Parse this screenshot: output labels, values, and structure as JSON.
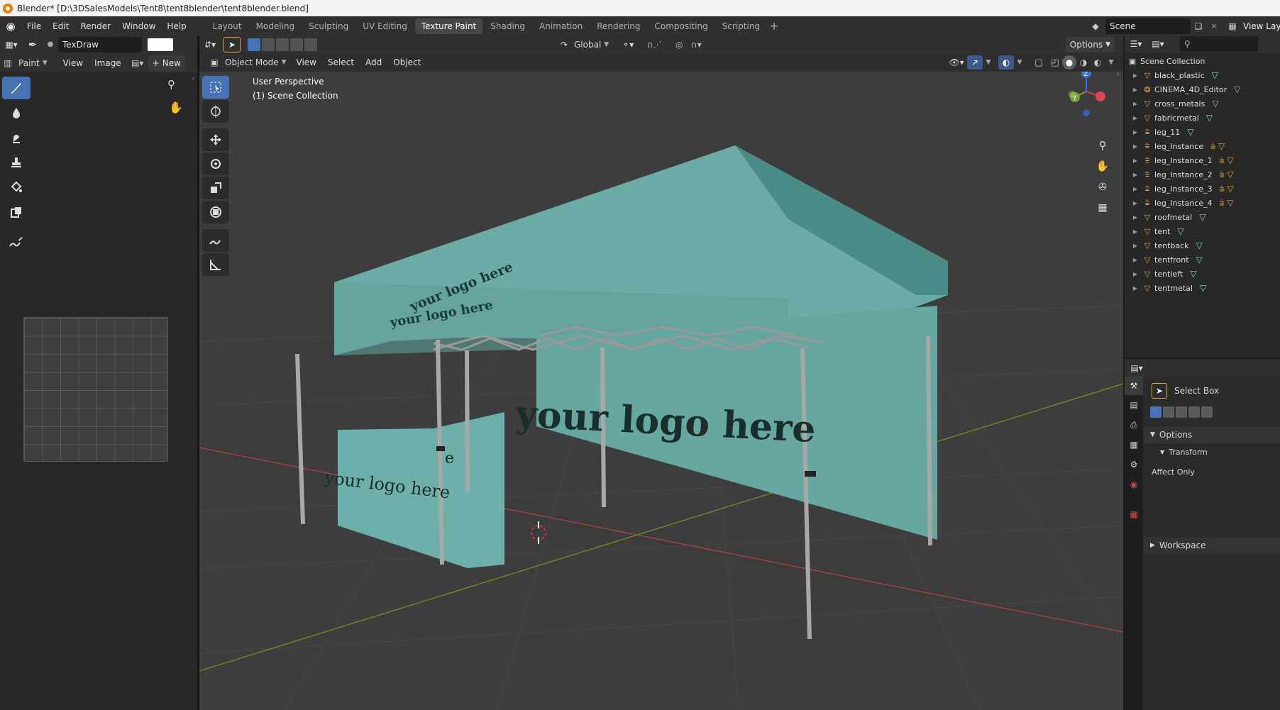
{
  "window_title": "Blender* [D:\\3DSalesModels\\Tent8\\tent8blender\\tent8blender.blend]",
  "menu": [
    "File",
    "Edit",
    "Render",
    "Window",
    "Help"
  ],
  "workspace_tabs": [
    "Layout",
    "Modeling",
    "Sculpting",
    "UV Editing",
    "Texture Paint",
    "Shading",
    "Animation",
    "Rendering",
    "Compositing",
    "Scripting"
  ],
  "active_workspace": "Texture Paint",
  "scene_name": "Scene",
  "view_layer_label": "View Laye",
  "image_editor": {
    "brush_name": "TexDraw",
    "mode": "Paint",
    "menus": [
      "View",
      "Image"
    ],
    "new_label": "New"
  },
  "viewport": {
    "mode": "Object Mode",
    "menus": [
      "View",
      "Select",
      "Add",
      "Object"
    ],
    "transform_orientation": "Global",
    "options_label": "Options",
    "overlay_line1": "User Perspective",
    "overlay_line2": "(1) Scene Collection",
    "tent_texts": [
      "your logo here",
      "your logo here",
      "your logo here",
      "your logo here",
      "e"
    ]
  },
  "outliner": {
    "root": "Scene Collection",
    "items": [
      "black_plastic",
      "CINEMA_4D_Editor",
      "cross_metals",
      "fabricmetal",
      "leg_11",
      "leg_Instance",
      "leg_Instance_1",
      "leg_Instance_2",
      "leg_Instance_3",
      "leg_Instance_4",
      "roofmetal",
      "tent",
      "tentback",
      "tentfront",
      "tentleft",
      "tentmetal"
    ]
  },
  "properties": {
    "tool_name": "Select Box",
    "options_label": "Options",
    "transform_label": "Transform",
    "affect_only_label": "Affect Only",
    "workspace_label": "Workspace"
  },
  "colors": {
    "accent": "#4772b3",
    "tent_fabric": "#6bada6",
    "object_icon": "#e89b44",
    "mesh_icon": "#7ed8b0",
    "axis_x": "#b0404a",
    "axis_y": "#7a9a2a"
  }
}
